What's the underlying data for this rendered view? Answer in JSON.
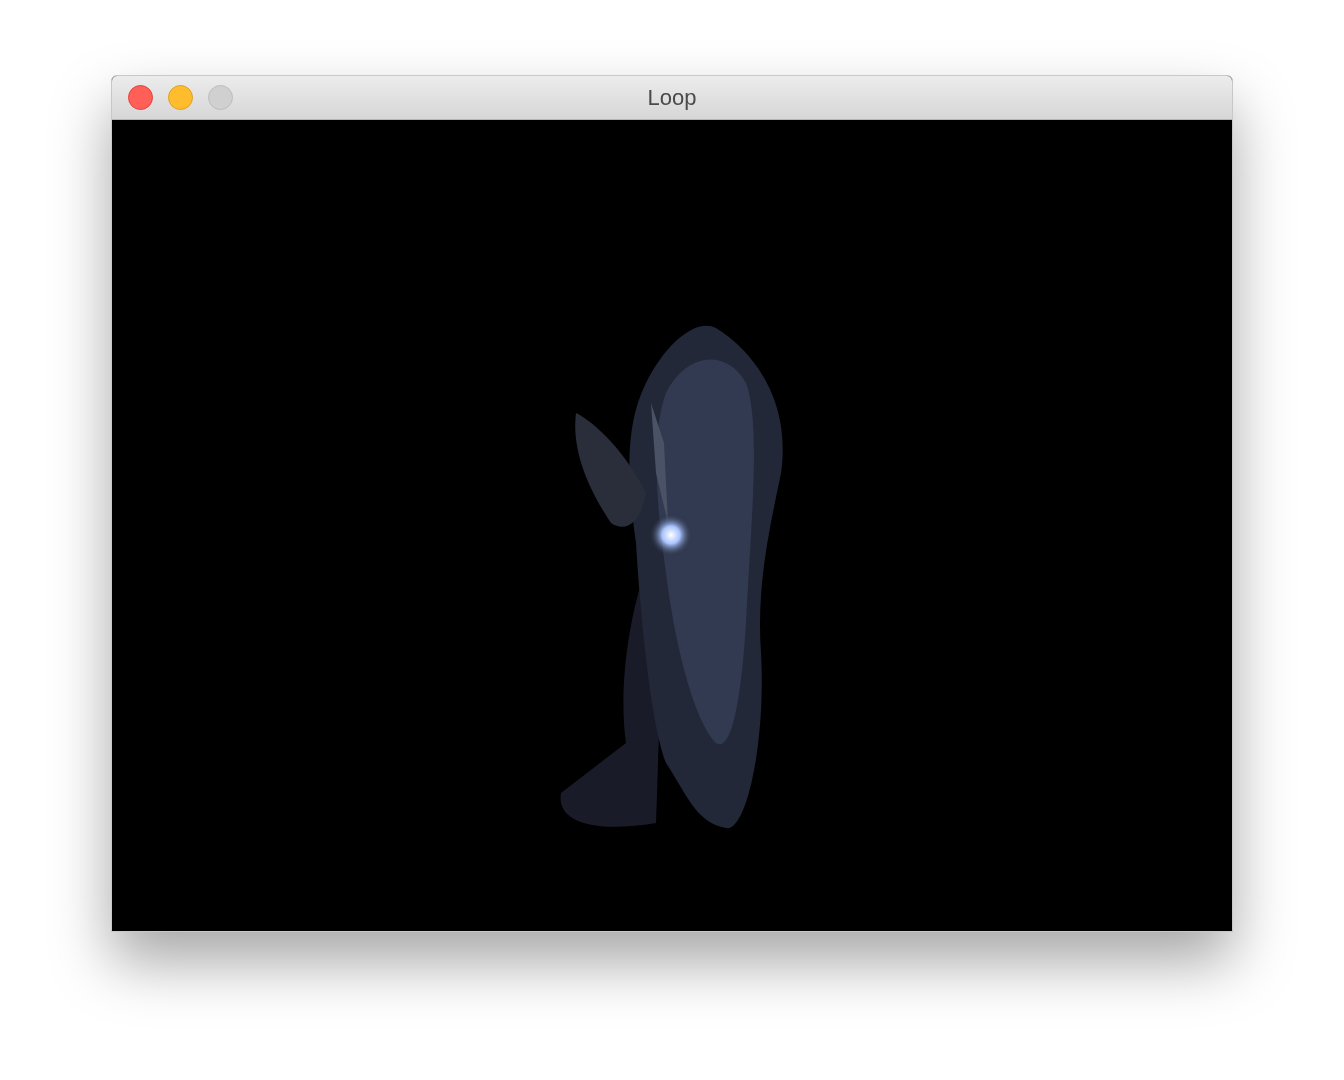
{
  "window": {
    "title": "Loop",
    "buttons": [
      {
        "kind": "close",
        "disabled": false
      },
      {
        "kind": "minimize",
        "disabled": false
      },
      {
        "kind": "zoom",
        "disabled": true
      }
    ]
  }
}
